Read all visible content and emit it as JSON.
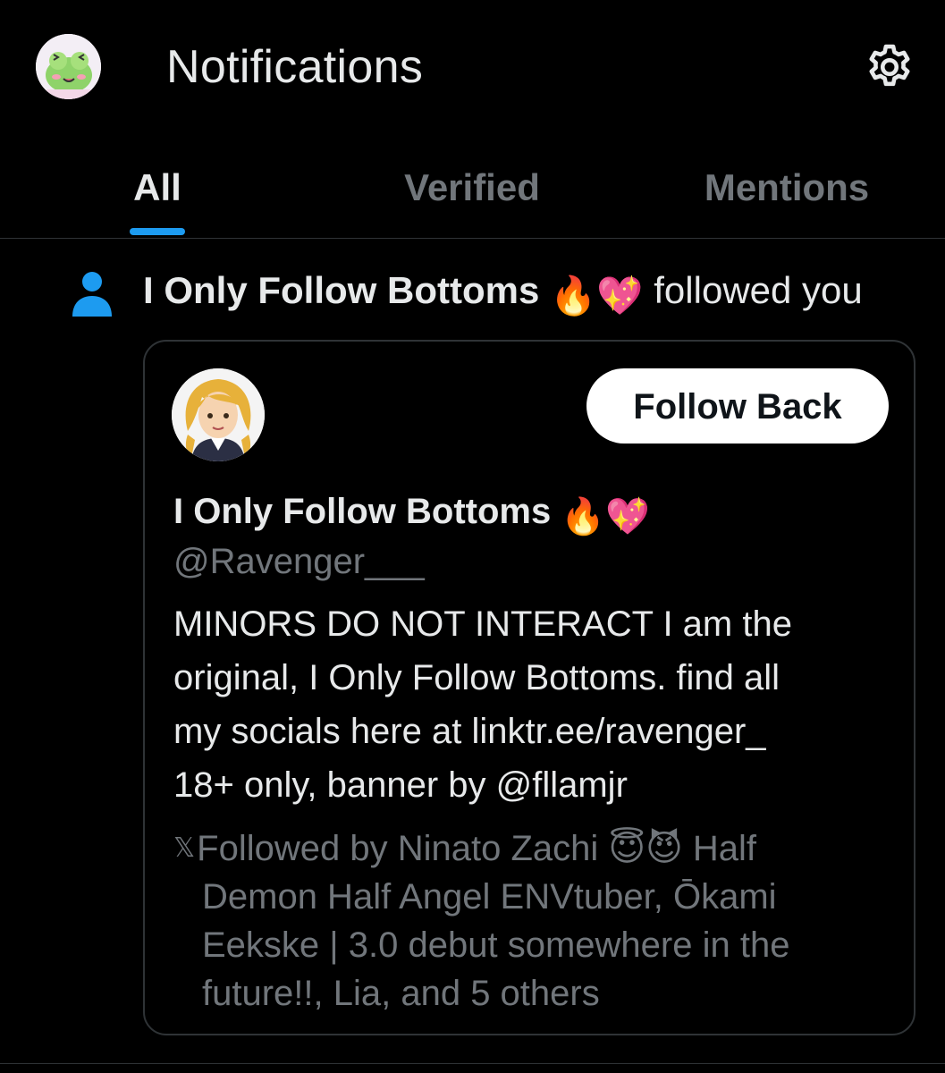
{
  "header": {
    "title": "Notifications",
    "avatar_icon": "frog-avatar",
    "settings_icon": "gear-icon"
  },
  "tabs": [
    {
      "label": "All",
      "active": true
    },
    {
      "label": "Verified",
      "active": false
    },
    {
      "label": "Mentions",
      "active": false
    }
  ],
  "notification": {
    "icon": "person-icon",
    "name": "I Only Follow Bottoms",
    "name_emoji": "🔥💖",
    "action": "followed you"
  },
  "card": {
    "name": "I Only Follow Bottoms",
    "name_emoji": "🔥💖",
    "handle": "@Ravenger___",
    "follow_button": "Follow Back",
    "bio_lines": [
      "MINORS DO NOT INTERACT I am the",
      "original, I Only Follow Bottoms. find all",
      "my socials here at linktr.ee/ravenger_",
      "18+ only, banner by @fllamjr"
    ],
    "followed_by_lines": [
      "Followed by Ninato Zachi 😇😈 Half",
      "Demon Half Angel ENVtuber, Ōkami",
      "Eekske | 3.0 debut somewhere in the",
      "future!!, Lia, and 5 others"
    ]
  },
  "colors": {
    "background": "#000000",
    "text": "#e7e9ea",
    "muted": "#71767b",
    "accent": "#1d9bf0",
    "border": "#2f3336"
  }
}
